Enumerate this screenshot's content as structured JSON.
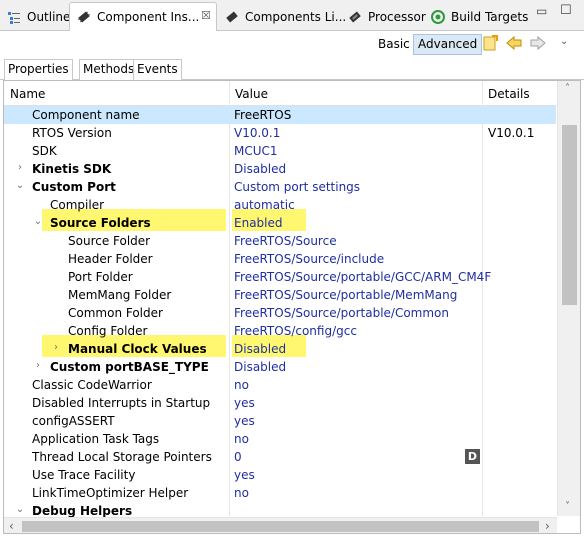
{
  "tabs": [
    {
      "label": "Outline",
      "icon": "outline-icon"
    },
    {
      "label": "Component Ins...",
      "icon": "component-inspector-icon",
      "active": true
    },
    {
      "label": "Components Li...",
      "icon": "components-library-icon"
    },
    {
      "label": "Processor",
      "icon": "processor-icon"
    },
    {
      "label": "Build Targets",
      "icon": "build-targets-icon"
    }
  ],
  "toolbar": {
    "basic_label": "Basic",
    "advanced_label": "Advanced"
  },
  "subtabs": {
    "properties": "Properties",
    "methods": "Methods",
    "events": "Events"
  },
  "columns": {
    "name": "Name",
    "value": "Value",
    "details": "Details"
  },
  "rows": [
    {
      "name": "Component name",
      "value": "FreeRTOS",
      "details": ""
    },
    {
      "name": "RTOS Version",
      "value": "V10.0.1",
      "details": "V10.0.1"
    },
    {
      "name": "SDK",
      "value": "MCUC1",
      "details": ""
    },
    {
      "name": "Kinetis SDK",
      "value": "Disabled",
      "details": ""
    },
    {
      "name": "Custom Port",
      "value": "Custom port settings",
      "details": ""
    },
    {
      "name": "Compiler",
      "value": "automatic",
      "details": ""
    },
    {
      "name": "Source Folders",
      "value": "Enabled",
      "details": ""
    },
    {
      "name": "Source Folder",
      "value": "FreeRTOS/Source",
      "details": ""
    },
    {
      "name": "Header Folder",
      "value": "FreeRTOS/Source/include",
      "details": ""
    },
    {
      "name": "Port Folder",
      "value": "FreeRTOS/Source/portable/GCC/ARM_CM4F",
      "details": ""
    },
    {
      "name": "MemMang Folder",
      "value": "FreeRTOS/Source/portable/MemMang",
      "details": ""
    },
    {
      "name": "Common Folder",
      "value": "FreeRTOS/Source/portable/Common",
      "details": ""
    },
    {
      "name": "Config Folder",
      "value": "FreeRTOS/config/gcc",
      "details": ""
    },
    {
      "name": "Manual Clock Values",
      "value": "Disabled",
      "details": ""
    },
    {
      "name": "Custom portBASE_TYPE",
      "value": "Disabled",
      "details": ""
    },
    {
      "name": "Classic CodeWarrior",
      "value": "no",
      "details": ""
    },
    {
      "name": "Disabled Interrupts in Startup",
      "value": "yes",
      "details": ""
    },
    {
      "name": "configASSERT",
      "value": "yes",
      "details": ""
    },
    {
      "name": "Application Task Tags",
      "value": "no",
      "details": ""
    },
    {
      "name": "Thread Local Storage Pointers",
      "value": "0",
      "details": "D"
    },
    {
      "name": "Use Trace Facility",
      "value": "yes",
      "details": ""
    },
    {
      "name": "LinkTimeOptimizer Helper",
      "value": "no",
      "details": ""
    },
    {
      "name": "Debug Helpers",
      "value": "",
      "details": ""
    }
  ],
  "colors": {
    "selection": "#cce8ff",
    "highlight": "#fff770",
    "value_text": "#1f2fa0"
  }
}
